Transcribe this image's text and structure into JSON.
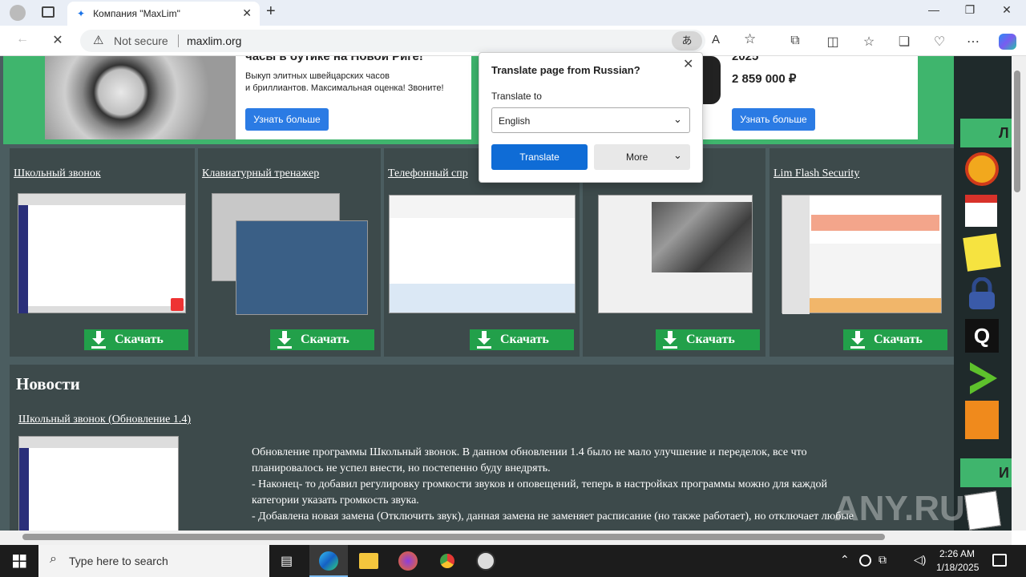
{
  "browser": {
    "tab_title": "Компания \"MaxLim\"",
    "not_secure": "Not secure",
    "url": "maxlim.org"
  },
  "ads": {
    "left_headline": "часы в бутике на Новой Риге!",
    "left_text1": "Выкуп элитных швейцарских часов",
    "left_text2": "и бриллиантов. Максимальная оценка! Звоните!",
    "left_button": "Узнать больше",
    "right_year": "2025",
    "right_price": "2 859 000 ₽",
    "right_button": "Узнать больше"
  },
  "programs": [
    {
      "name": "Школьный звонок",
      "download": "Скачать"
    },
    {
      "name": "Клавиатурный тренажер",
      "download": "Скачать"
    },
    {
      "name": "Телефонный спр",
      "download": "Скачать"
    },
    {
      "name": "",
      "download": "Скачать"
    },
    {
      "name": "Lim Flash Security",
      "download": "Скачать"
    }
  ],
  "news": {
    "heading": "Новости",
    "item_title": "Школьный звонок (Обновление 1.4)",
    "line1": "Обновление программы Школьный звонок. В данном обновлении 1.4 было не мало улучшение и переделок, все что",
    "line2": "планировалось не успел внести, но постепенно буду внедрять.",
    "line3": "- Наконец- то добавил регулировку громкости звуков и оповещений, теперь в настройках программы можно для каждой",
    "line4": "категории указать громкость звука.",
    "line5": "- Добавлена новая замена (Отключить звук), данная замена не заменяет расписание (но также работает), но отключает любые"
  },
  "side_tabs": {
    "top": "Л",
    "bottom": "И"
  },
  "translate_popup": {
    "title": "Translate page from Russian?",
    "translate_to_label": "Translate to",
    "language": "English",
    "translate_button": "Translate",
    "more_button": "More"
  },
  "taskbar": {
    "search_placeholder": "Type here to search",
    "time": "2:26 AM",
    "date": "1/18/2025"
  },
  "watermark": "ANY.RUN"
}
